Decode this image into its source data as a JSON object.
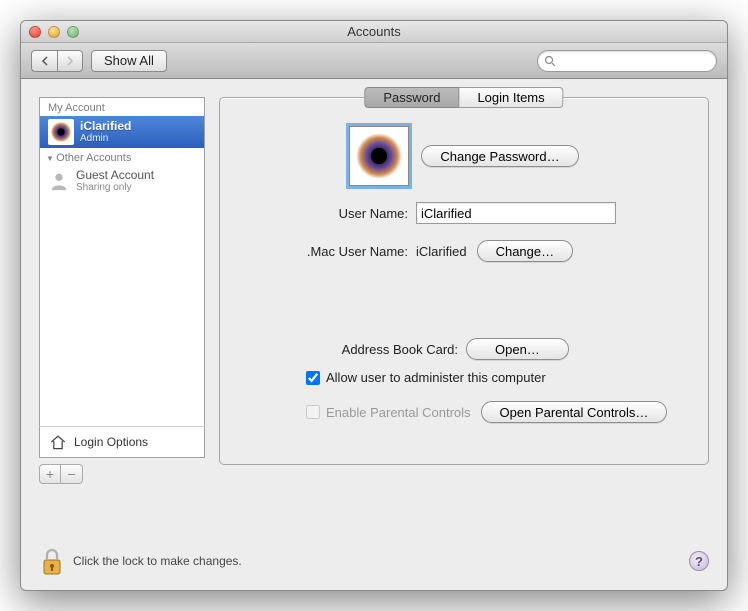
{
  "window": {
    "title": "Accounts"
  },
  "toolbar": {
    "show_all": "Show All"
  },
  "search": {
    "placeholder": ""
  },
  "sidebar": {
    "my_account_header": "My Account",
    "other_accounts_header": "Other Accounts",
    "accounts": [
      {
        "name": "iClarified",
        "role": "Admin"
      }
    ],
    "guest": {
      "name": "Guest Account",
      "role": "Sharing only"
    },
    "login_options": "Login Options",
    "add": "+",
    "remove": "−"
  },
  "tabs": {
    "password": "Password",
    "login_items": "Login Items"
  },
  "main": {
    "change_password": "Change Password…",
    "user_name_label": "User Name:",
    "user_name_value": "iClarified",
    "mac_user_name_label": ".Mac User Name:",
    "mac_user_name_value": "iClarified",
    "change": "Change…",
    "address_book_label": "Address Book Card:",
    "open": "Open…",
    "allow_admin": "Allow user to administer this computer",
    "enable_parental": "Enable Parental Controls",
    "open_parental": "Open Parental Controls…"
  },
  "footer": {
    "lock": "Click the lock to make changes."
  }
}
